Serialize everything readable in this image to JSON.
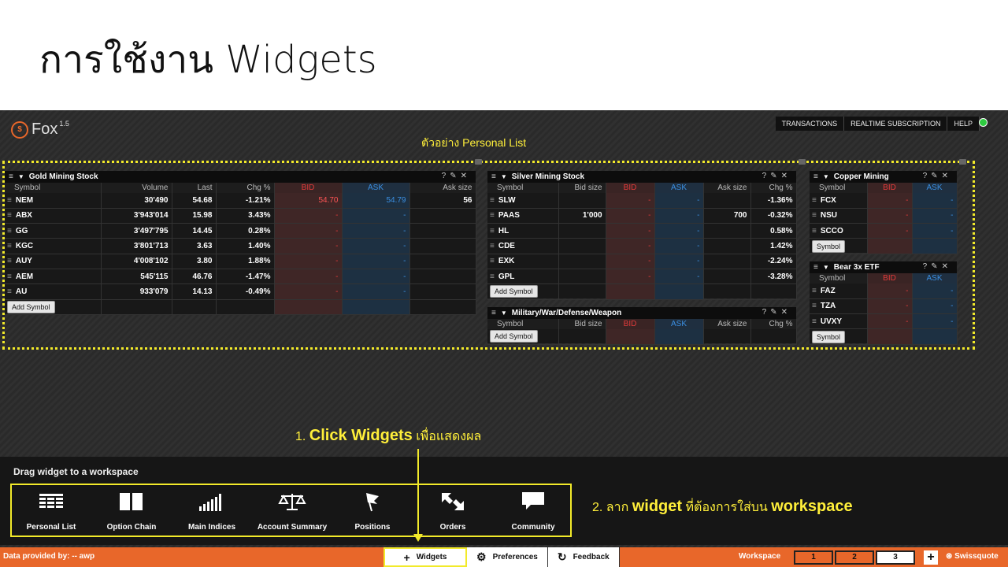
{
  "slide": {
    "title": "การใช้งาน Widgets"
  },
  "app": {
    "logo": {
      "name": "Fox",
      "version": "1.5"
    },
    "topnav": [
      "TRANSACTIONS",
      "REALTIME SUBSCRIPTION",
      "HELP"
    ],
    "example_label": "ตัวอย่าง Personal List"
  },
  "widgets": {
    "gold": {
      "title": "Gold Mining Stock",
      "columns": [
        "Symbol",
        "Volume",
        "Last",
        "Chg %",
        "BID",
        "ASK",
        "Ask size"
      ],
      "rows": [
        {
          "symbol": "NEM",
          "volume": "30'490",
          "last": "54.68",
          "chg": "-1.21%",
          "bid": "54.70",
          "ask": "54.79",
          "asksize": "56"
        },
        {
          "symbol": "ABX",
          "volume": "3'943'014",
          "last": "15.98",
          "chg": "3.43%",
          "bid": "-",
          "ask": "-",
          "asksize": ""
        },
        {
          "symbol": "GG",
          "volume": "3'497'795",
          "last": "14.45",
          "chg": "0.28%",
          "bid": "-",
          "ask": "-",
          "asksize": ""
        },
        {
          "symbol": "KGC",
          "volume": "3'801'713",
          "last": "3.63",
          "chg": "1.40%",
          "bid": "-",
          "ask": "-",
          "asksize": ""
        },
        {
          "symbol": "AUY",
          "volume": "4'008'102",
          "last": "3.80",
          "chg": "1.88%",
          "bid": "-",
          "ask": "-",
          "asksize": ""
        },
        {
          "symbol": "AEM",
          "volume": "545'115",
          "last": "46.76",
          "chg": "-1.47%",
          "bid": "-",
          "ask": "-",
          "asksize": ""
        },
        {
          "symbol": "AU",
          "volume": "933'079",
          "last": "14.13",
          "chg": "-0.49%",
          "bid": "-",
          "ask": "-",
          "asksize": ""
        }
      ],
      "add_label": "Add Symbol"
    },
    "silver": {
      "title": "Silver Mining Stock",
      "columns": [
        "Symbol",
        "Bid size",
        "BID",
        "ASK",
        "Ask size",
        "Chg %"
      ],
      "rows": [
        {
          "symbol": "SLW",
          "bidsize": "",
          "bid": "-",
          "ask": "-",
          "asksize": "",
          "chg": "-1.36%"
        },
        {
          "symbol": "PAAS",
          "bidsize": "1'000",
          "bid": "-",
          "ask": "-",
          "asksize": "700",
          "chg": "-0.32%"
        },
        {
          "symbol": "HL",
          "bidsize": "",
          "bid": "-",
          "ask": "-",
          "asksize": "",
          "chg": "0.58%"
        },
        {
          "symbol": "CDE",
          "bidsize": "",
          "bid": "-",
          "ask": "-",
          "asksize": "",
          "chg": "1.42%"
        },
        {
          "symbol": "EXK",
          "bidsize": "",
          "bid": "-",
          "ask": "-",
          "asksize": "",
          "chg": "-2.24%"
        },
        {
          "symbol": "GPL",
          "bidsize": "",
          "bid": "-",
          "ask": "-",
          "asksize": "",
          "chg": "-3.28%"
        }
      ],
      "add_label": "Add Symbol"
    },
    "military": {
      "title": "Military/War/Defense/Weapon",
      "columns": [
        "Symbol",
        "Bid size",
        "BID",
        "ASK",
        "Ask size",
        "Chg %"
      ],
      "add_label": "Add Symbol"
    },
    "copper": {
      "title": "Copper Mining",
      "columns": [
        "Symbol",
        "BID",
        "ASK"
      ],
      "rows": [
        {
          "symbol": "FCX",
          "bid": "-",
          "ask": "-"
        },
        {
          "symbol": "NSU",
          "bid": "-",
          "ask": "-"
        },
        {
          "symbol": "SCCO",
          "bid": "-",
          "ask": "-"
        }
      ],
      "add_label": "Symbol"
    },
    "bear": {
      "title": "Bear 3x ETF",
      "columns": [
        "Symbol",
        "BID",
        "ASK"
      ],
      "rows": [
        {
          "symbol": "FAZ",
          "bid": "-",
          "ask": "-"
        },
        {
          "symbol": "TZA",
          "bid": "-",
          "ask": "-"
        },
        {
          "symbol": "UVXY",
          "bid": "-",
          "ask": "-"
        }
      ],
      "add_label": "Symbol"
    }
  },
  "palette": {
    "title": "Drag widget to a workspace",
    "items": [
      {
        "label": "Personal List",
        "icon": "list-icon"
      },
      {
        "label": "Option Chain",
        "icon": "book-icon"
      },
      {
        "label": "Main Indices",
        "icon": "bars-icon"
      },
      {
        "label": "Account Summary",
        "icon": "scale-icon"
      },
      {
        "label": "Positions",
        "icon": "flag-icon"
      },
      {
        "label": "Orders",
        "icon": "arrows-icon"
      },
      {
        "label": "Community",
        "icon": "chat-icon"
      }
    ]
  },
  "annotations": {
    "step1_prefix": "1. ",
    "step1_bold": "Click Widgets",
    "step1_suffix": " เพื่อแสดงผล",
    "step2_prefix": "2. ลาก ",
    "step2_bold1": "widget",
    "step2_mid": " ที่ต้องการใส่บน ",
    "step2_bold2": "workspace"
  },
  "bottom": {
    "data_provided": "Data provided by: -- awp",
    "tabs": [
      "Widgets",
      "Preferences",
      "Feedback"
    ],
    "workspace_label": "Workspace",
    "workspaces": [
      "1",
      "2",
      "3"
    ],
    "plus": "+",
    "brand": "Swissquote"
  },
  "colors": {
    "accent": "#e8672a",
    "highlight": "#f2ea2a",
    "bid": "#e23b3b",
    "ask": "#3b8fe2"
  }
}
